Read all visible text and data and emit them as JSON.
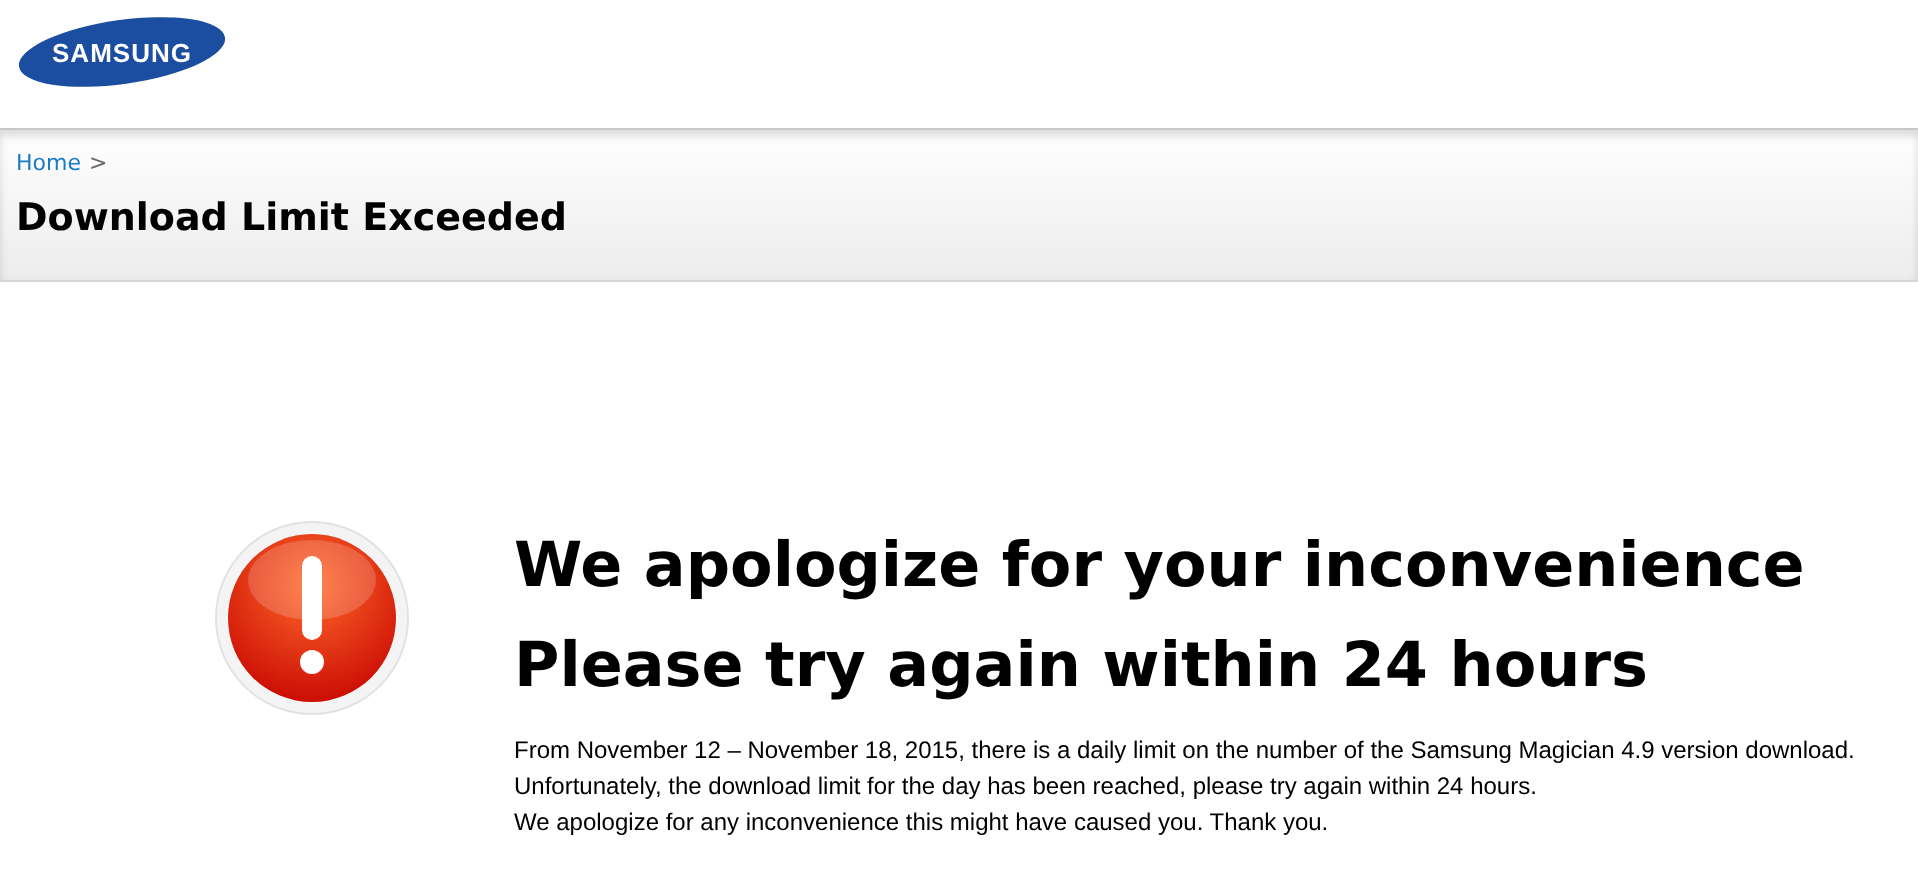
{
  "header": {
    "logo": "SAMSUNG"
  },
  "breadcrumb": {
    "items": [
      "Home"
    ],
    "separator": ">"
  },
  "page_title": "Download Limit Exceeded",
  "message": {
    "headings": [
      "We apologize for your inconvenience",
      "Please try again within 24 hours"
    ],
    "lines": [
      "From November 12 – November 18, 2015, there is a daily limit on the number of the Samsung Magician 4.9 version download.",
      "Unfortunately, the download limit for the day has been reached, please try again within 24 hours.",
      "We apologize for any inconvenience this might have caused you. Thank you."
    ]
  }
}
